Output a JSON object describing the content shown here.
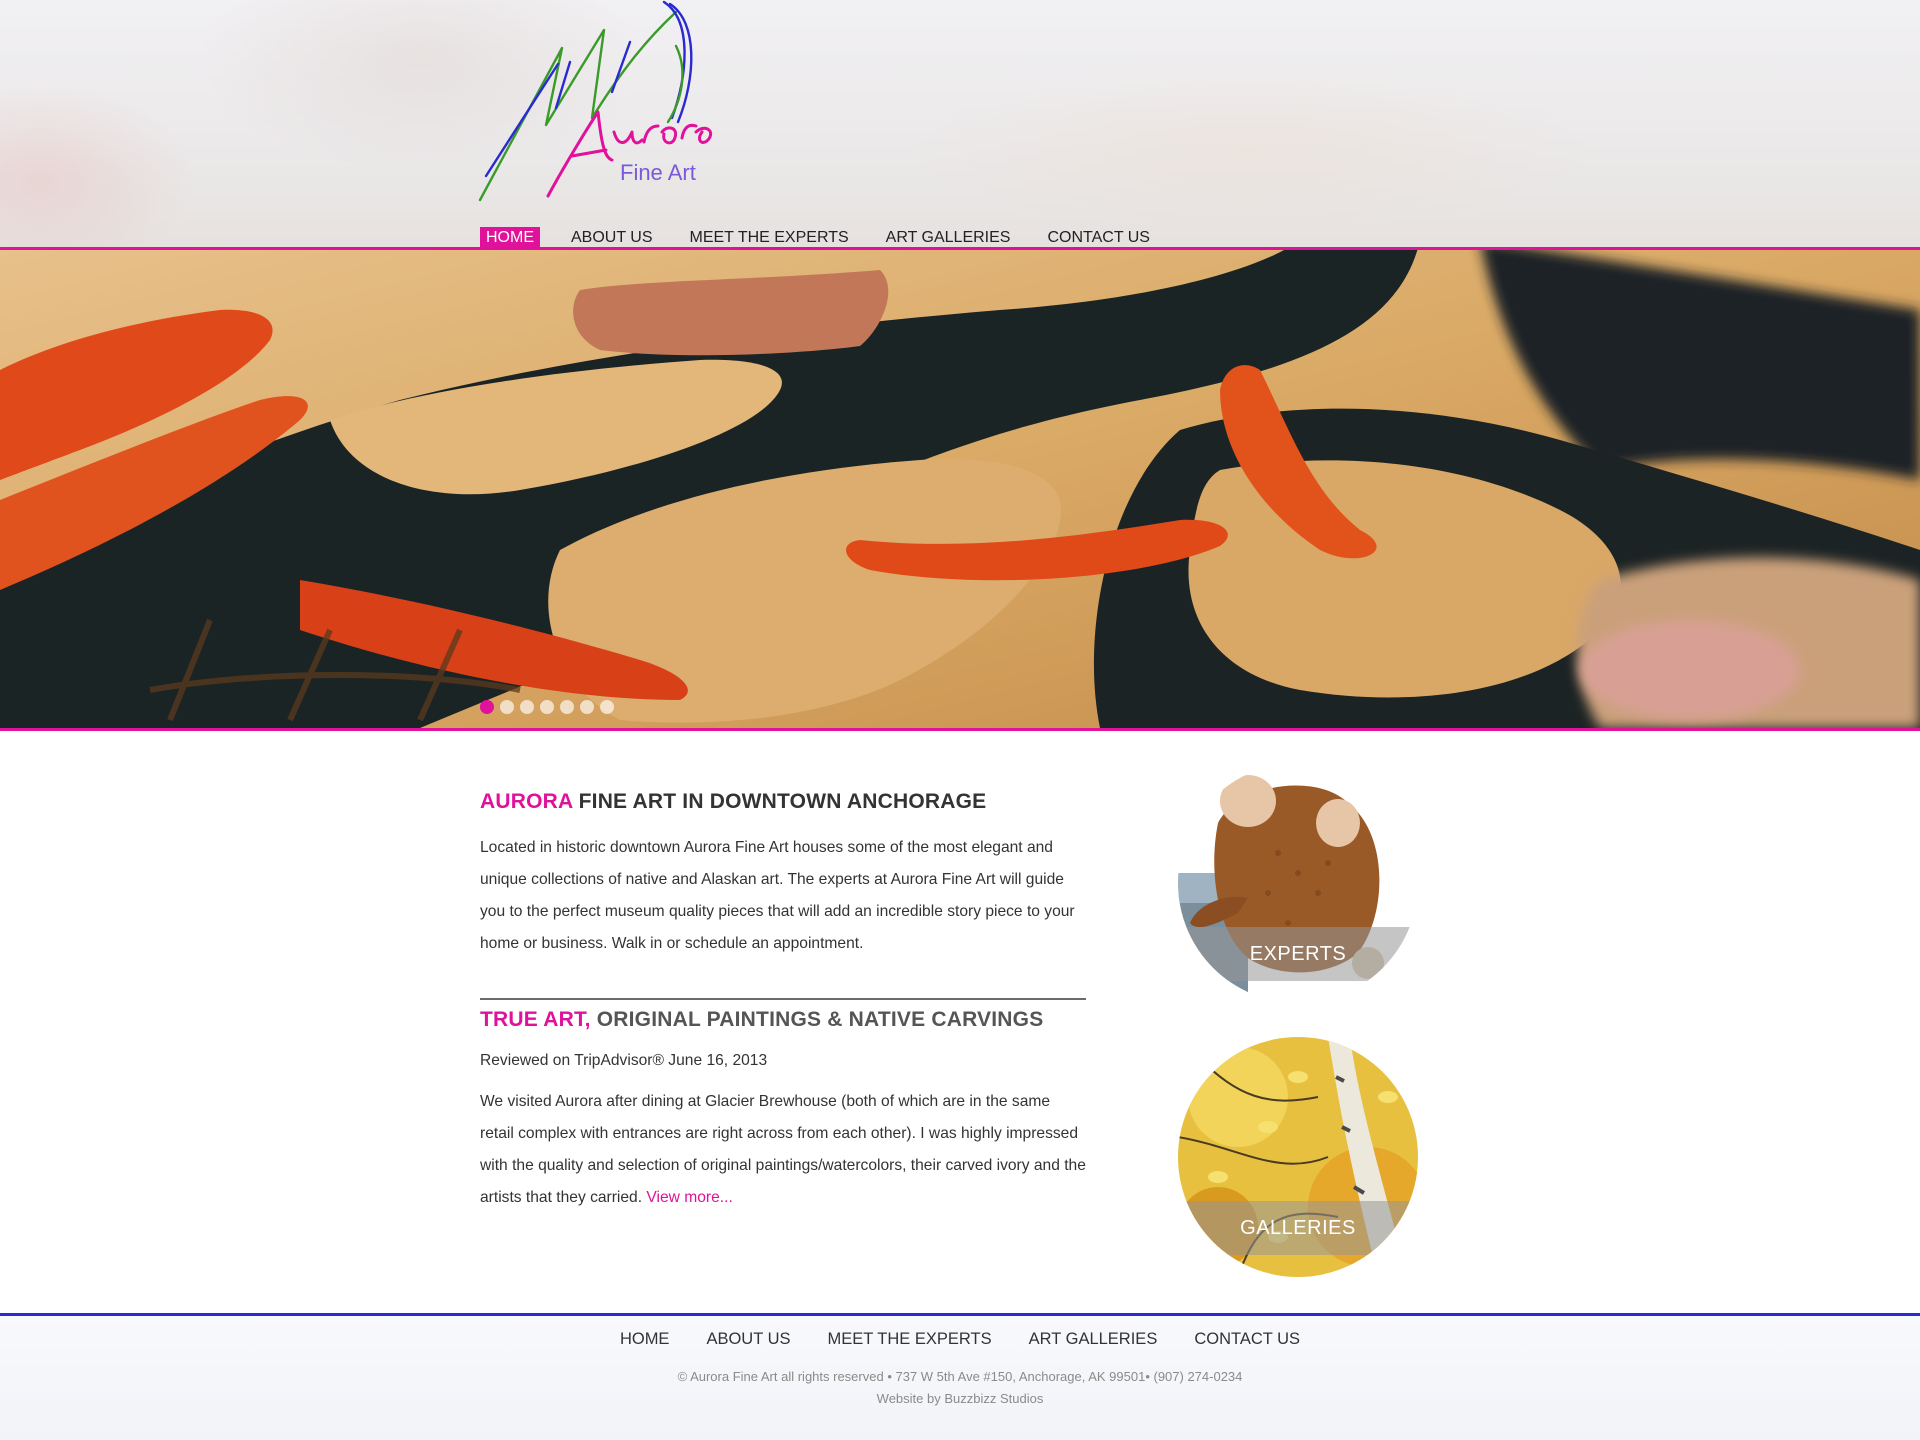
{
  "site": {
    "logo": {
      "script": "Aurora",
      "sub": "Fine Art"
    }
  },
  "nav": {
    "items": [
      {
        "label": "HOME",
        "active": true
      },
      {
        "label": "ABOUT US"
      },
      {
        "label": "MEET THE EXPERTS"
      },
      {
        "label": "ART GALLERIES"
      },
      {
        "label": "CONTACT US"
      }
    ]
  },
  "slider": {
    "slide_count": 7,
    "active_index": 0
  },
  "section1": {
    "heading_accent": "AURORA",
    "heading_rest": " FINE ART IN DOWNTOWN ANCHORAGE",
    "body": "Located in historic downtown Aurora Fine Art houses some of the most elegant and unique collections of native and Alaskan art.  The experts at Aurora Fine Art will guide you to the perfect museum quality pieces that will add an incredible story piece to your home or business. Walk in or schedule an appointment."
  },
  "section2": {
    "heading_accent": "TRUE ART,",
    "heading_rest": " ORIGINAL PAINTINGS & NATIVE CARVINGS",
    "reviewed": "Reviewed on TripAdvisor® June 16, 2013",
    "body": "We visited Aurora after dining at Glacier Brewhouse (both of which are in the same retail complex with entrances are right across from each other). I was highly impressed with the quality and selection of original paintings/watercolors, their carved ivory and the artists that they carried. ",
    "view_more": "View more..."
  },
  "circles": {
    "experts": "EXPERTS",
    "galleries": "GALLERIES"
  },
  "footer": {
    "nav": [
      "HOME",
      "ABOUT US",
      "MEET THE EXPERTS",
      "ART GALLERIES",
      "CONTACT US"
    ],
    "copyright": "© Aurora Fine Art all rights reserved • 737 W 5th Ave #150, Anchorage, AK 99501• (907) 274-0234",
    "credit": "Website by Buzzbizz Studios"
  },
  "colors": {
    "accent": "#e0119a",
    "footer_border": "#2a2ad0",
    "logo_green": "#3a9a2a",
    "logo_blue": "#2a2ad0",
    "logo_purple": "#7a5ad8"
  }
}
